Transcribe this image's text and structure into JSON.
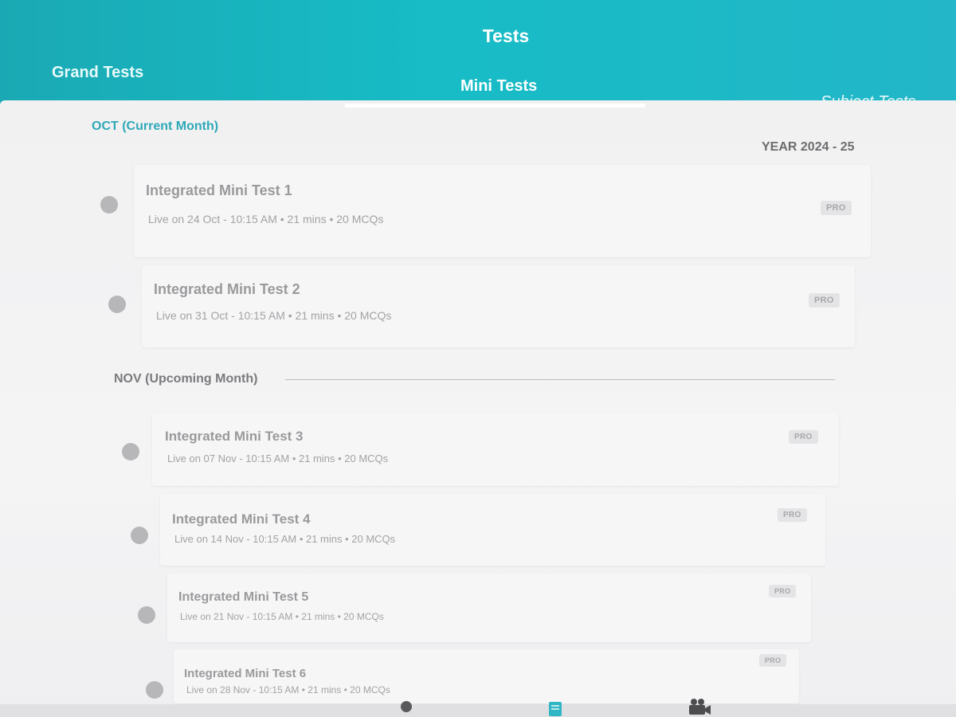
{
  "header": {
    "title": "Tests",
    "tabs": [
      {
        "label": "Grand Tests"
      },
      {
        "label": "Mini Tests"
      },
      {
        "label": "Subject Tests"
      }
    ]
  },
  "sections": {
    "current": {
      "label": "OCT (Current Month)",
      "year": "YEAR 2024 - 25"
    },
    "upcoming": {
      "label": "NOV (Upcoming Month)"
    }
  },
  "tests": [
    {
      "title": "Integrated Mini Test 1",
      "meta": "Live on 24 Oct - 10:15 AM • 21 mins • 20 MCQs",
      "badge": "PRO"
    },
    {
      "title": "Integrated Mini Test 2",
      "meta": "Live on 31 Oct - 10:15 AM • 21 mins • 20 MCQs",
      "badge": "PRO"
    },
    {
      "title": "Integrated Mini Test 3",
      "meta": "Live on 07 Nov - 10:15 AM • 21 mins • 20 MCQs",
      "badge": "PRO"
    },
    {
      "title": "Integrated Mini Test 4",
      "meta": "Live on 14 Nov - 10:15 AM • 21 mins • 20 MCQs",
      "badge": "PRO"
    },
    {
      "title": "Integrated Mini Test 5",
      "meta": "Live on 21 Nov - 10:15 AM • 21 mins • 20 MCQs",
      "badge": "PRO"
    },
    {
      "title": "Integrated Mini Test 6",
      "meta": "Live on 28 Nov - 10:15 AM • 21 mins • 20 MCQs",
      "badge": "PRO"
    }
  ],
  "bottom_nav": {
    "icons": [
      "profile-icon",
      "tests-icon",
      "video-icon"
    ],
    "active_color": "#2fb6c4"
  },
  "colors": {
    "accent": "#17bcc6",
    "current_month": "#2fa9b8"
  }
}
